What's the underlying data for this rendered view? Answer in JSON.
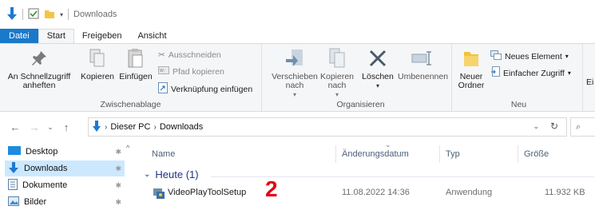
{
  "titlebar": {
    "title": "Downloads"
  },
  "tabs": [
    {
      "label": "Datei"
    },
    {
      "label": "Start"
    },
    {
      "label": "Freigeben"
    },
    {
      "label": "Ansicht"
    }
  ],
  "ribbon": {
    "clipboard": {
      "label": "Zwischenablage",
      "pin": "An Schnellzugriff anheften",
      "copy": "Kopieren",
      "paste": "Einfügen",
      "cut": "Ausschneiden",
      "copy_path": "Pfad kopieren",
      "paste_shortcut": "Verknüpfung einfügen"
    },
    "organize": {
      "label": "Organisieren",
      "move_to": "Verschieben nach",
      "copy_to": "Kopieren nach",
      "delete": "Löschen",
      "rename": "Umbenennen"
    },
    "new": {
      "label": "Neu",
      "new_folder": "Neuer Ordner",
      "new_item": "Neues Element",
      "easy_access": "Einfacher Zugriff"
    },
    "cut_off_label": "Ei"
  },
  "address": {
    "crumbs": [
      "Dieser PC",
      "Downloads"
    ]
  },
  "navpane": {
    "items": [
      {
        "label": "Desktop"
      },
      {
        "label": "Downloads"
      },
      {
        "label": "Dokumente"
      },
      {
        "label": "Bilder"
      }
    ]
  },
  "columns": {
    "name": "Name",
    "date": "Änderungsdatum",
    "type": "Typ",
    "size": "Größe"
  },
  "group": {
    "label": "Heute (1)"
  },
  "files": [
    {
      "name": "VideoPlayToolSetup",
      "date": "11.08.2022 14:36",
      "type": "Anwendung",
      "size": "11.932 KB"
    }
  ],
  "annotation": {
    "text": "2",
    "color": "#e3000f"
  },
  "colors": {
    "file_tab": "#1979ca",
    "selection": "#cce8ff",
    "group_heading": "#1e3287"
  }
}
